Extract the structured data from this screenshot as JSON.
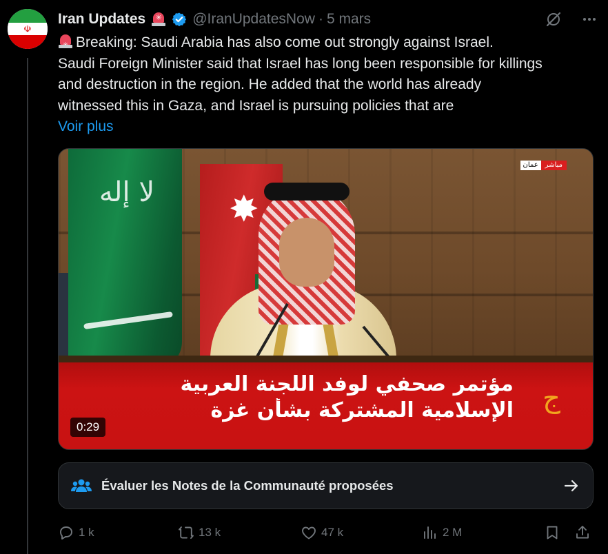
{
  "tweet": {
    "author_name": "Iran Updates",
    "handle": "@IranUpdatesNow",
    "separator": "·",
    "date": "5 mars",
    "text_lines": [
      "Breaking: Saudi Arabia has also come out strongly against Israel.",
      "Saudi Foreign Minister said that Israel has long been responsible for killings",
      "and destruction in the region. He added that the world has already",
      "witnessed this in Gaza, and Israel is pursuing policies that are"
    ],
    "show_more": "Voir plus"
  },
  "media": {
    "live_city": "عمان",
    "live_tag": "مباشر",
    "banner_line1": "مؤتمر صحفي لوفد اللجنة العربية",
    "banner_line2": "الإسلامية المشتركة بشأن غزة",
    "duration": "0:29"
  },
  "community_notes": {
    "label": "Évaluer les Notes de la Communauté proposées"
  },
  "actions": {
    "replies": "1 k",
    "reposts": "13 k",
    "likes": "47 k",
    "views": "2 M"
  },
  "icons": {
    "grok": "grok-icon",
    "more": "more-icon",
    "reply": "reply-icon",
    "repost": "repost-icon",
    "like": "like-icon",
    "views": "views-icon",
    "bookmark": "bookmark-icon",
    "share": "share-icon"
  },
  "colors": {
    "background": "#000000",
    "text": "#e7e9ea",
    "muted": "#71767b",
    "accent": "#1d9bf0"
  }
}
